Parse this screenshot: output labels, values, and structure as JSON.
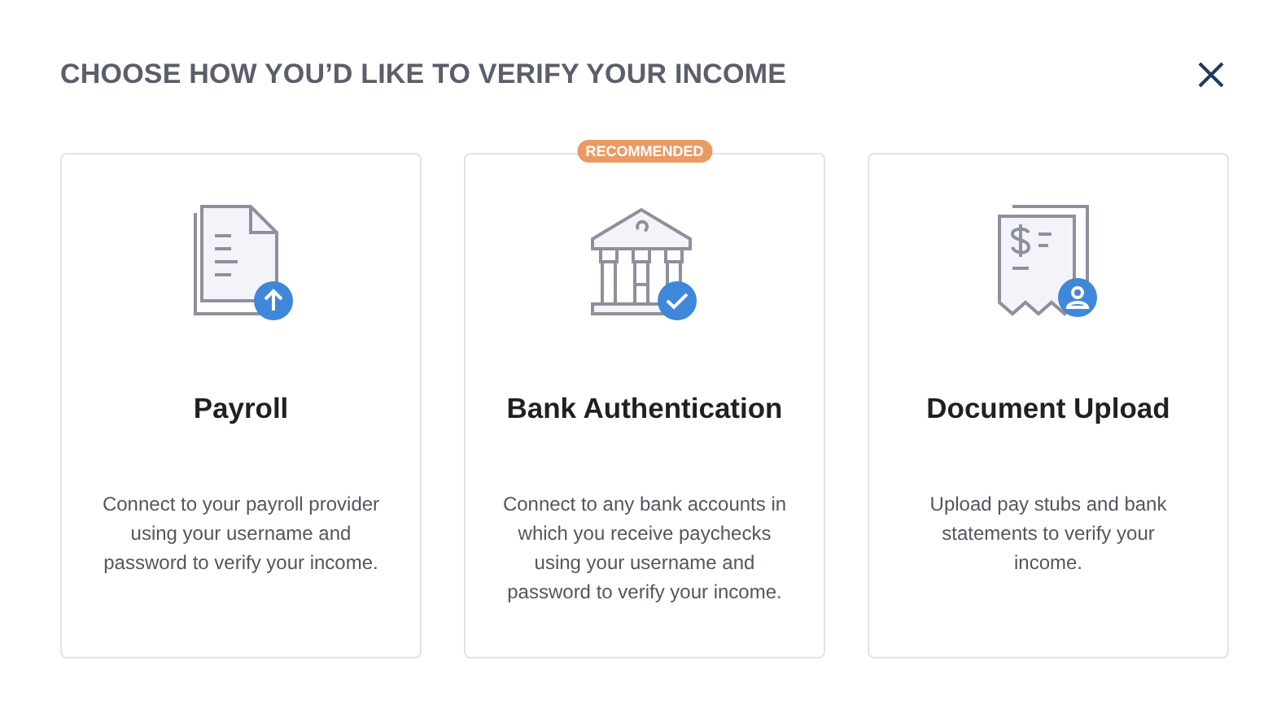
{
  "title": "CHOOSE HOW YOU’D LIKE TO VERIFY YOUR INCOME",
  "options": [
    {
      "kind": "payroll",
      "name": "Payroll",
      "description": "Connect to your payroll provider using your username and password to verify your income."
    },
    {
      "kind": "bank",
      "badge": "RECOMMENDED",
      "name": "Bank Authentication",
      "description": "Connect to any bank accounts in which you receive paychecks using your username and password to verify your income."
    },
    {
      "kind": "document",
      "name": "Document Upload",
      "description": "Upload pay stubs and bank statements to verify your income."
    }
  ]
}
